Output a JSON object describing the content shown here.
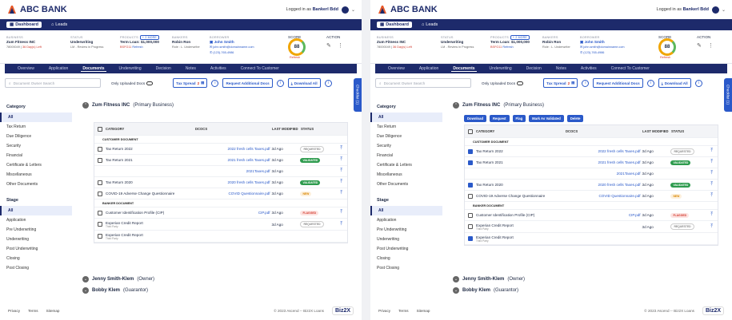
{
  "header": {
    "brand": "ABC BANK",
    "login_prefix": "Logged in as",
    "login_user": "Bankerl Bdd"
  },
  "nav": {
    "dashboard": "Dashboard",
    "leads": "Leads"
  },
  "summary": {
    "business_lbl": "BUSINESS",
    "business": "Zum Fitness INC",
    "business_id": "78000049",
    "business_days": "36 Day(s) Left",
    "status_lbl": "STATUS",
    "status": "Underwriting",
    "status_sub": "LM - Review in Progress",
    "products_lbl": "PRODUCTS",
    "more": "+ 2 MORE",
    "product": "Term Loan: $1,000,000",
    "product_code": "BSFG11",
    "refresh": "Refresh",
    "banker_lbl": "BANKERS",
    "banker": "Robin Ron",
    "banker_role": "Role : L. Underwriter",
    "borrower_lbl": "BORROWER",
    "borrower": "John Smith",
    "email": "john.smith@domainname.com",
    "phone": "(123)-765-4986",
    "score_lbl": "SCORE",
    "score": "88",
    "score_refresh": "Refresh",
    "action_lbl": "ACTION"
  },
  "tabs": [
    "Overview",
    "Application",
    "Documents",
    "Underwriting",
    "Decision",
    "Notes",
    "Activities",
    "Connect To Customer"
  ],
  "toolbar": {
    "search_placeholder": "Document Owner Search",
    "only_uploaded": "Only Uploaded Docs",
    "tax_spread": "Tax Spread",
    "tax_count": "2",
    "request_docs": "Request Additional Docs",
    "download_all": "Download All",
    "side_tab": "Checklist (1)"
  },
  "category": {
    "title": "Category",
    "items": [
      "All",
      "Tax Return",
      "Due Diligence",
      "Security",
      "Financial",
      "Certificate & Letters",
      "Miscellaneous",
      "Other Documents"
    ]
  },
  "stage": {
    "title": "Stage",
    "items": [
      "All",
      "Application",
      "Pre Underwriting",
      "Underwriting",
      "Post Underwriting",
      "Closing",
      "Post Closing"
    ]
  },
  "owner1": {
    "name": "Zum Fitness INC",
    "role": "(Primary Business)"
  },
  "owner2": {
    "name": "Jenny Smith-Klem",
    "role": "(Owner)"
  },
  "owner3": {
    "name": "Bobby Klem",
    "role": "(Guarantor)"
  },
  "bulk": [
    "Download",
    "Request",
    "Flag",
    "Mark As Validated",
    "Delete"
  ],
  "table": {
    "h_category": "CATEGORY",
    "h_docs": "DCOCS",
    "h_modified": "LAST MODIFIED",
    "h_status": "STATUS",
    "sec_customer": "CUSTOMER DOCUMENT",
    "sec_banker": "BANKER DOCUMENT",
    "rows": [
      {
        "cat": "Tax Return 2022",
        "doc": "2022 fresh cells Taxes.pdf",
        "mod": "3d Ago",
        "status": "REQUESTED"
      },
      {
        "cat": "Tax Return 2021",
        "doc": "2021 fresh cells Taxes.pdf",
        "mod": "3d Ago",
        "status": "VALIDATED"
      },
      {
        "cat": "",
        "doc": "2021Taxes.pdf",
        "mod": "3d Ago",
        "status": ""
      },
      {
        "cat": "Tax Return 2020",
        "doc": "2020 fresh cells Taxes.pdf",
        "mod": "3d Ago",
        "status": "VALIDATED"
      },
      {
        "cat": "COVID-19 Adverse Change Questionnaire",
        "doc": "COVID Questionnaire.pdf",
        "mod": "3d Ago",
        "status": "NEW"
      },
      {
        "cat": "Customer Identification Profile (CIP)",
        "doc": "CIP.pdf",
        "mod": "3d Ago",
        "status": "FLAGGED"
      },
      {
        "cat": "Experian Credit Report",
        "sub": "Third Party",
        "doc": "",
        "mod": "3d Ago",
        "status": "REQUESTED"
      },
      {
        "cat": "Experian Credit Report",
        "sub": "Third Party",
        "doc": "",
        "mod": "",
        "status": ""
      }
    ]
  },
  "footer": {
    "privacy": "Privacy",
    "terms": "Terms",
    "sitemap": "Sitemap",
    "copyright": "© 2023 Ascend -- Biz2X Loans",
    "biz": "Biz2X"
  }
}
